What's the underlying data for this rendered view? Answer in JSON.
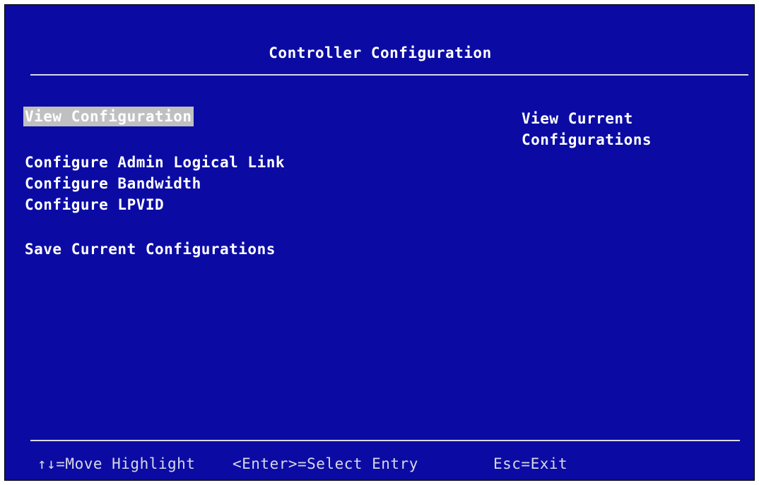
{
  "screen": {
    "title": "Controller Configuration"
  },
  "menu": {
    "items": [
      {
        "label": "View Configuration",
        "selected": true
      },
      {
        "label": "Configure Admin Logical Link",
        "selected": false
      },
      {
        "label": "Configure Bandwidth",
        "selected": false
      },
      {
        "label": "Configure LPVID",
        "selected": false
      },
      {
        "label": "Save Current Configurations",
        "selected": false
      }
    ]
  },
  "help": {
    "line1": "View Current",
    "line2": "Configurations"
  },
  "footer": {
    "move": "↑↓=Move Highlight",
    "select": "<Enter>=Select Entry",
    "exit": "Esc=Exit"
  },
  "colors": {
    "background": "#0b0ba4",
    "text": "#ffffff",
    "highlight": "#c0c0c0"
  }
}
